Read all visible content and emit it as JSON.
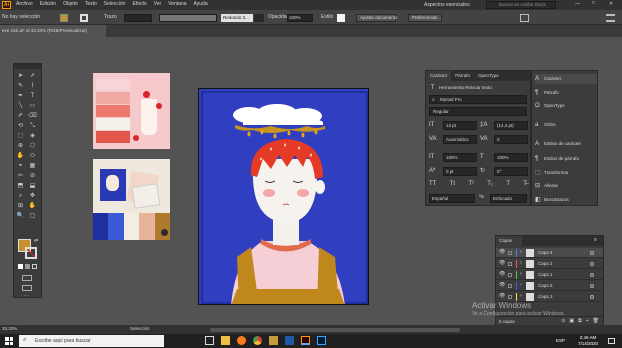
{
  "app": {
    "logo": "Ai",
    "menu": [
      "Archivo",
      "Edición",
      "Objeto",
      "Texto",
      "Selección",
      "Efecto",
      "Ver",
      "Ventana",
      "Ayuda"
    ],
    "workspace": "Aspectos esenciales",
    "search_placeholder": "Buscar en Adobe Stock",
    "accent": "#ff9a00"
  },
  "control_bar": {
    "selection": "No hay selección",
    "stroke_label": "Trazo",
    "brush": "Redondo 3...",
    "opacity_label": "Opacidad",
    "opacity_value": "100%",
    "style_label": "Estilo",
    "align_button": "Ajustar documento",
    "prefs_button": "Preferencias"
  },
  "document": {
    "tab_title": "eve sick.ai* al 33,33% (RGB/Previsualizar)",
    "artboard_color": "#2f3fc0"
  },
  "character_panel": {
    "tabs": [
      "Carácter",
      "Párrafo",
      "OpenType"
    ],
    "touch_type": "Herramienta Retocar texto",
    "font": "Myriad Pro",
    "style": "Regular",
    "size": "12 pt",
    "leading": "(14,4 pt)",
    "kerning": "Automático",
    "tracking": "0",
    "vscale": "100%",
    "hscale": "100%",
    "baseline": "0 pt",
    "rotation": "0°",
    "language": "Español",
    "antialias": "Enfocado"
  },
  "panel_dock": {
    "items": [
      "Carácter",
      "Párrafo",
      "OpenType",
      "Glifos",
      "Estilos de carácter",
      "Estilos de párrafo",
      "Transformar",
      "Alinear",
      "Buscatrazos"
    ]
  },
  "layers_panel": {
    "title": "Capas",
    "layers": [
      "Capa 4",
      "Capa 2",
      "Capa 1",
      "Capa 5",
      "Capa 3"
    ],
    "footer": "5 capas"
  },
  "status_bar": {
    "zoom": "33,33%",
    "tool": "Selección"
  },
  "activation": {
    "title": "Activar Windows",
    "subtitle": "Ve a Configuración para activar Windows."
  },
  "taskbar": {
    "search_placeholder": "Escribe aquí para buscar",
    "time": "2:46 AM",
    "date": "7/14/2020",
    "lang": "ESP"
  },
  "palette": [
    "#1f2f9e",
    "#3b5bd6",
    "#f4ede2",
    "#e9b39a",
    "#b07a2e"
  ]
}
